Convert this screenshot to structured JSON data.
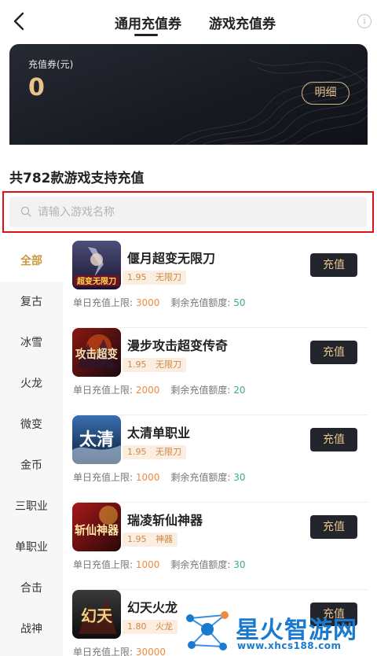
{
  "header": {
    "tabs": [
      {
        "label": "通用充值券",
        "active": true
      },
      {
        "label": "游戏充值券",
        "active": false
      }
    ],
    "info_icon": "info-circle-icon"
  },
  "balance_card": {
    "label": "充值券(元)",
    "value": "0",
    "detail_button": "明细"
  },
  "summary": {
    "count_title": "共782款游戏支持充值"
  },
  "search": {
    "placeholder": "请输入游戏名称",
    "value": ""
  },
  "categories": [
    {
      "label": "全部",
      "active": true
    },
    {
      "label": "复古",
      "active": false
    },
    {
      "label": "冰雪",
      "active": false
    },
    {
      "label": "火龙",
      "active": false
    },
    {
      "label": "微变",
      "active": false
    },
    {
      "label": "金币",
      "active": false
    },
    {
      "label": "三职业",
      "active": false
    },
    {
      "label": "单职业",
      "active": false
    },
    {
      "label": "合击",
      "active": false
    },
    {
      "label": "战神",
      "active": false
    }
  ],
  "list_labels": {
    "single_limit": "单日充值上限: ",
    "remaining": "剩余充值额度: ",
    "charge_button": "充值"
  },
  "games": [
    {
      "name": "偃月超变无限刀",
      "discount": "1.95",
      "tag": "无限刀",
      "single_limit": "3000",
      "remaining": "50",
      "cover_text": "超变无限刀"
    },
    {
      "name": "漫步攻击超变传奇",
      "discount": "1.95",
      "tag": "无限刀",
      "single_limit": "2000",
      "remaining": "20",
      "cover_text": "攻击超变"
    },
    {
      "name": "太清单职业",
      "discount": "1.95",
      "tag": "无限刀",
      "single_limit": "1000",
      "remaining": "30",
      "cover_text": "太清"
    },
    {
      "name": "瑞凌斩仙神器",
      "discount": "1.95",
      "tag": "神器",
      "single_limit": "1000",
      "remaining": "30",
      "cover_text": "斩仙神器"
    },
    {
      "name": "幻天火龙",
      "discount": "1.80",
      "tag": "火龙",
      "single_limit": "30000",
      "remaining": "",
      "cover_text": "幻天"
    }
  ],
  "watermark": {
    "text": "星火智游网",
    "url": "www.xhcs188.com"
  },
  "colors": {
    "accent_gold": "#e7c48a",
    "card_dark": "#171a21",
    "highlight_red": "#e01010",
    "limit_orange": "#f08a3c",
    "remaining_green": "#3bb16f",
    "watermark_blue": "#1a7ad0"
  }
}
